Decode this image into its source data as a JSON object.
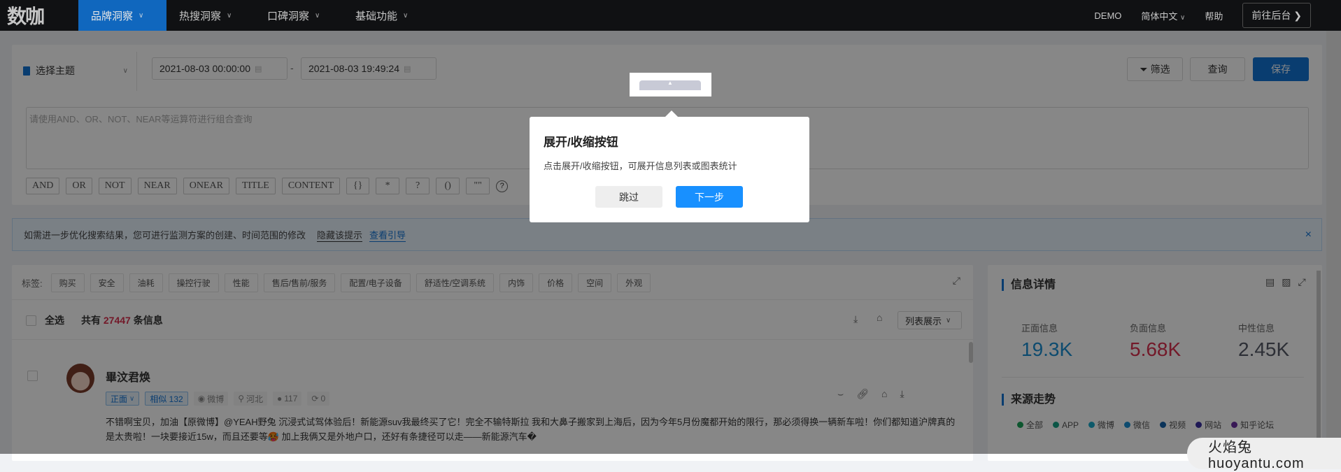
{
  "nav": {
    "logo": "数咖",
    "items": [
      {
        "label": "品牌洞察",
        "active": true
      },
      {
        "label": "热搜洞察"
      },
      {
        "label": "口碑洞察"
      },
      {
        "label": "基础功能"
      }
    ],
    "demo": "DEMO",
    "language": "简体中文",
    "help": "帮助",
    "backend": "前往后台"
  },
  "search": {
    "theme": "选择主题",
    "start": "2021-08-03 00:00:00",
    "end": "2021-08-03 19:49:24",
    "sep": "-",
    "filter": "筛选",
    "query": "查询",
    "save": "保存",
    "placeholder": "请使用AND、OR、NOT、NEAR等运算符进行组合查询",
    "operators": [
      "AND",
      "OR",
      "NOT",
      "NEAR",
      "ONEAR",
      "TITLE",
      "CONTENT",
      "{}",
      "*",
      "?",
      "()",
      "\"\""
    ],
    "help": "?"
  },
  "hint": {
    "text": "如需进一步优化搜索结果，您可进行监测方案的创建、时间范围的修改",
    "hide": "隐藏该提示",
    "guide": "查看引导",
    "close": "×"
  },
  "tags": {
    "label": "标签:",
    "items": [
      "购买",
      "安全",
      "油耗",
      "操控行驶",
      "性能",
      "售后/售前/服务",
      "配置/电子设备",
      "舒适性/空调系统",
      "内饰",
      "价格",
      "空间",
      "外观"
    ]
  },
  "list": {
    "select_all": "全选",
    "count_prefix": "共有",
    "count": "27447",
    "count_suffix": "条信息",
    "view": "列表展示"
  },
  "post": {
    "author": "畢汶君焕",
    "sentiment": "正面",
    "similar": "相似 132",
    "source": "微博",
    "location": "河北",
    "followers": "117",
    "reposts": "0",
    "content": "不错啊宝贝，加油【原微博】@YEAH野兔 沉浸式试驾体验后！新能源suv我最终买了它！完全不输特斯拉 我和大鼻子搬家到上海后，因为今年5月份魔都开始的限行，那必须得换一辆新车啦！你们都知道沪牌真的是太贵啦！一块要接近15w，而且还要等🥵 加上我俩又是外地户口，还好有条捷径可以走——新能源汽车�"
  },
  "detail": {
    "title": "信息详情",
    "stats": [
      {
        "label": "正面信息",
        "value": "19.3K",
        "color": "#1a8fd1"
      },
      {
        "label": "负面信息",
        "value": "5.68K",
        "color": "#d9304f"
      },
      {
        "label": "中性信息",
        "value": "2.45K",
        "color": "#555a66"
      }
    ],
    "trend_title": "来源走势",
    "legend": [
      {
        "label": "全部",
        "color": "#1aa35a"
      },
      {
        "label": "APP",
        "color": "#16a085"
      },
      {
        "label": "微博",
        "color": "#1aa8c8"
      },
      {
        "label": "微信",
        "color": "#1a8fd1"
      },
      {
        "label": "视频",
        "color": "#1460a8"
      },
      {
        "label": "网站",
        "color": "#3a2fa0"
      },
      {
        "label": "知乎论坛",
        "color": "#6a2fa0"
      }
    ]
  },
  "guide": {
    "title": "展开/收缩按钮",
    "desc": "点击展开/收缩按钮，可展开信息列表或图表统计",
    "skip": "跳过",
    "next": "下一步"
  },
  "watermark": "火焰兔 huoyantu.com"
}
